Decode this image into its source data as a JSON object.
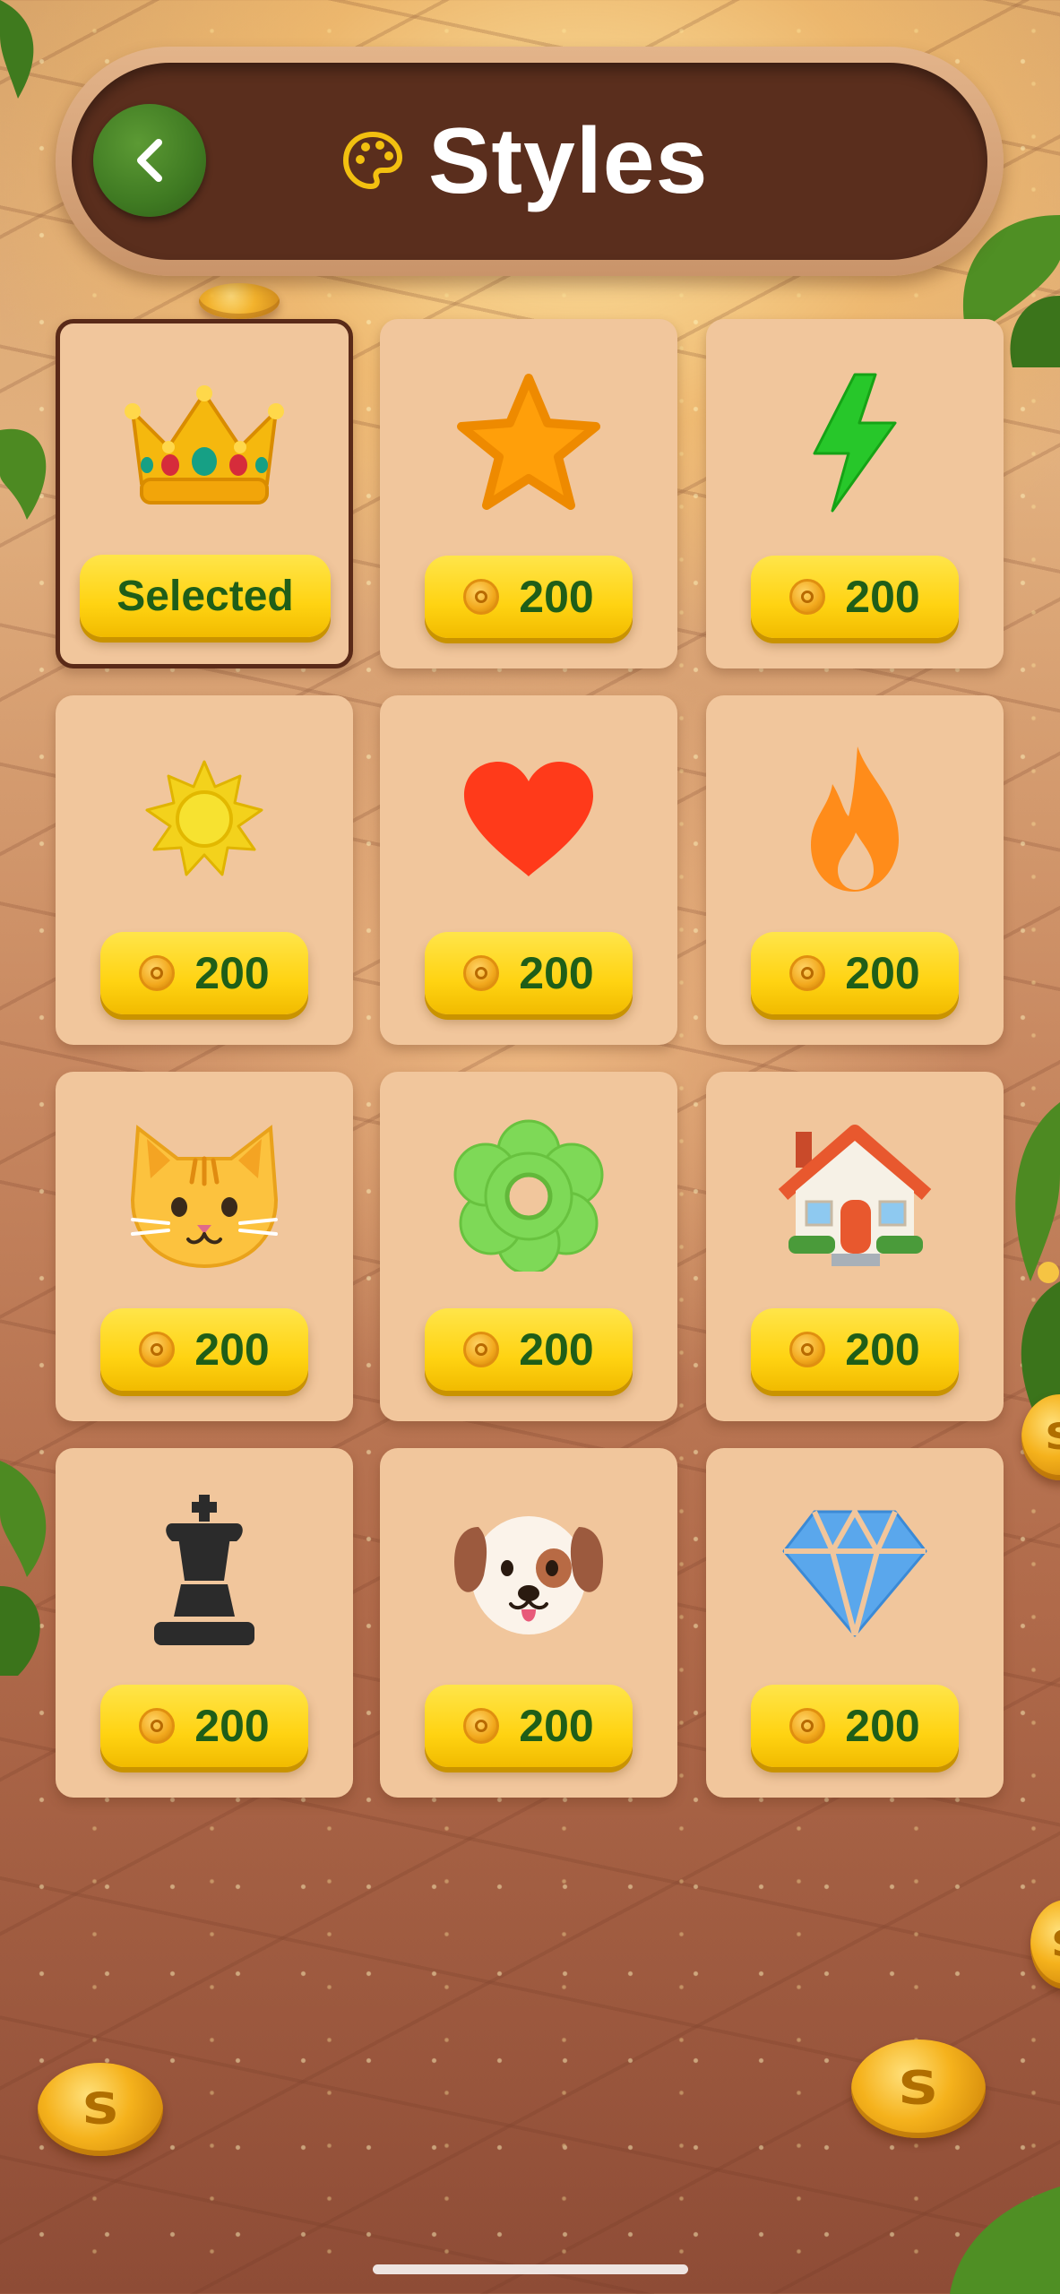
{
  "header": {
    "title": "Styles",
    "back_icon": "chevron-left-icon",
    "title_icon": "palette-icon"
  },
  "colors": {
    "header_bar": "#5a2e1d",
    "header_rim": "#d9a87c",
    "card": "#f1c69c",
    "price_button": "#ffd312",
    "price_text": "#1f5e18",
    "back_button": "#3f7a22",
    "selected_border": "#5a2a18"
  },
  "styles": [
    {
      "id": "crown",
      "icon": "crown-icon",
      "status": "Selected",
      "selected": true
    },
    {
      "id": "star",
      "icon": "star-icon",
      "price": "200",
      "selected": false
    },
    {
      "id": "lightning",
      "icon": "lightning-icon",
      "price": "200",
      "selected": false
    },
    {
      "id": "sun",
      "icon": "sun-icon",
      "price": "200",
      "selected": false
    },
    {
      "id": "heart",
      "icon": "heart-icon",
      "price": "200",
      "selected": false
    },
    {
      "id": "fire",
      "icon": "fire-icon",
      "price": "200",
      "selected": false
    },
    {
      "id": "cat",
      "icon": "cat-face-icon",
      "price": "200",
      "selected": false
    },
    {
      "id": "flower",
      "icon": "flower-icon",
      "price": "200",
      "selected": false
    },
    {
      "id": "house",
      "icon": "house-icon",
      "price": "200",
      "selected": false
    },
    {
      "id": "chess",
      "icon": "chess-king-icon",
      "price": "200",
      "selected": false
    },
    {
      "id": "dog",
      "icon": "dog-face-icon",
      "price": "200",
      "selected": false
    },
    {
      "id": "diamond",
      "icon": "diamond-icon",
      "price": "200",
      "selected": false
    }
  ],
  "background": {
    "coin_symbol": "S"
  }
}
